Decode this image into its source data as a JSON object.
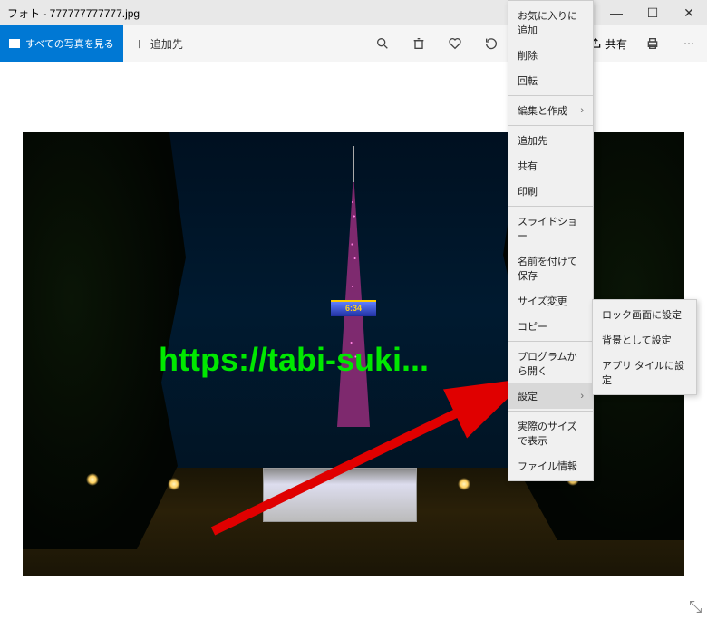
{
  "titlebar": {
    "title": "フォト - 777777777777.jpg"
  },
  "toolbar": {
    "all_photos": "すべての写真を見る",
    "add_to": "追加先",
    "share": "共有"
  },
  "photo": {
    "clock": "6:34",
    "watermark": "https://tabi-suki..."
  },
  "context_menu": [
    {
      "label": "お気に入りに追加"
    },
    {
      "label": "削除"
    },
    {
      "label": "回転"
    },
    {
      "sep": true
    },
    {
      "label": "編集と作成",
      "sub": true
    },
    {
      "sep": true
    },
    {
      "label": "追加先"
    },
    {
      "label": "共有"
    },
    {
      "label": "印刷"
    },
    {
      "sep": true
    },
    {
      "label": "スライドショー"
    },
    {
      "label": "名前を付けて保存"
    },
    {
      "label": "サイズ変更"
    },
    {
      "label": "コピー"
    },
    {
      "sep": true
    },
    {
      "label": "プログラムから開く"
    },
    {
      "label": "設定",
      "sub": true,
      "highlighted": true
    },
    {
      "sep": true
    },
    {
      "label": "実際のサイズで表示"
    },
    {
      "label": "ファイル情報"
    }
  ],
  "submenu": [
    {
      "label": "ロック画面に設定"
    },
    {
      "label": "背景として設定"
    },
    {
      "label": "アプリ タイルに設定"
    }
  ]
}
